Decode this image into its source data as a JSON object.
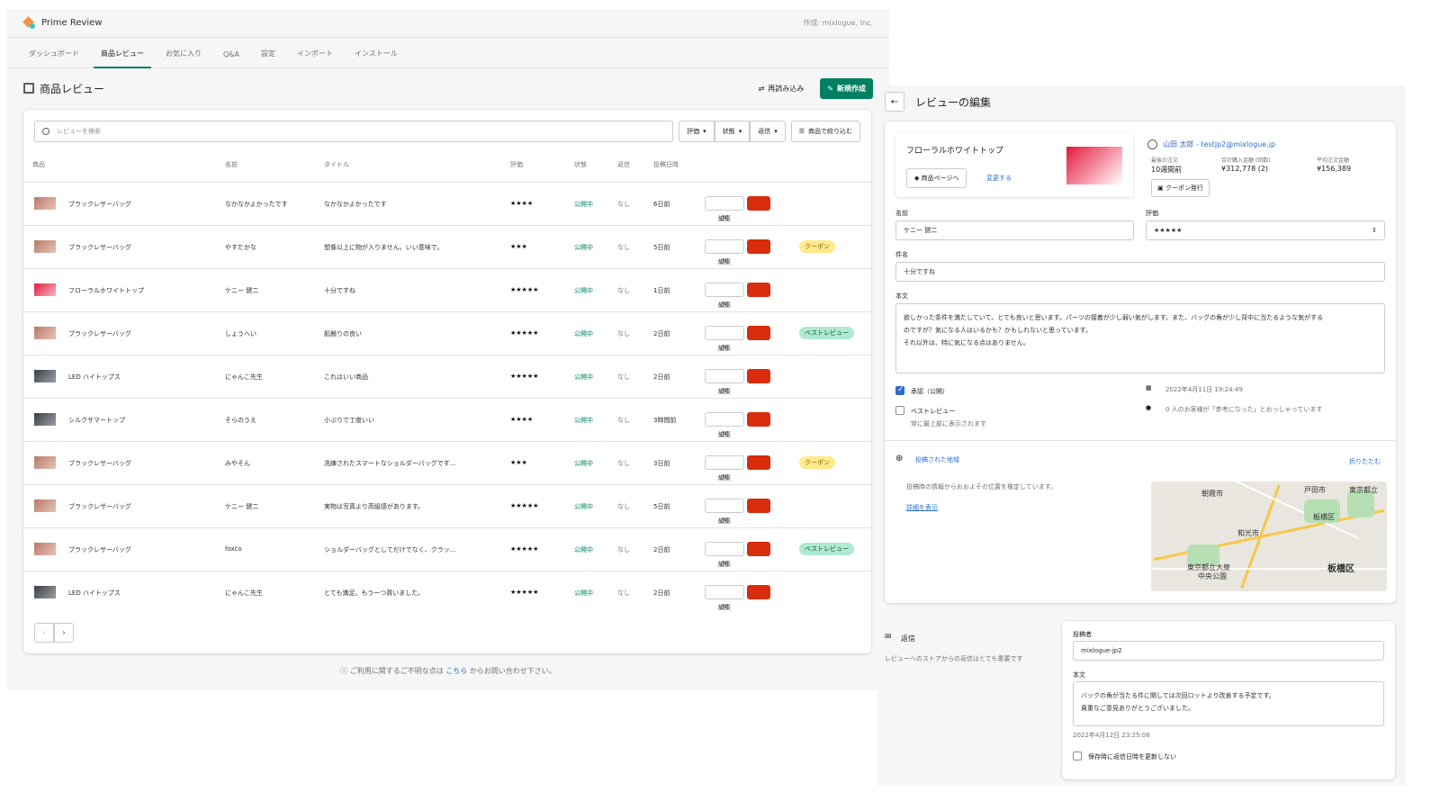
{
  "app": {
    "title": "Prime Review",
    "author": "作成: mixlogue, Inc."
  },
  "tabs": [
    "ダッシュボード",
    "商品レビュー",
    "お気に入り",
    "Q&A",
    "設定",
    "インポート",
    "インストール"
  ],
  "page": {
    "title": "商品レビュー",
    "reload": "再読み込み",
    "new": "新規作成"
  },
  "filters": {
    "search_placeholder": "レビューを検索",
    "rating": "評価",
    "status": "状態",
    "reply": "返信",
    "product": "商品で絞り込む"
  },
  "columns": [
    "商品",
    "名前",
    "タイトル",
    "評価",
    "状態",
    "返信",
    "投稿日時"
  ],
  "row_actions": {
    "edit": "編集"
  },
  "rows": [
    {
      "product": "ブラックレザーバッグ",
      "name": "なかなかよかったです",
      "title": "なかなかよかったです",
      "stars": "★★★★",
      "status": "公開中",
      "reply": "なし",
      "date": "6日前",
      "badge": "",
      "thumb": "bag"
    },
    {
      "product": "ブラックレザーバッグ",
      "name": "やすたかな",
      "title": "想像以上に物が入りません。いい意味で。",
      "stars": "★★★",
      "status": "公開中",
      "reply": "なし",
      "date": "5日前",
      "badge": "クーポン",
      "thumb": "bag"
    },
    {
      "product": "フローラルホワイトトップ",
      "name": "ケニー 健二",
      "title": "十分ですね",
      "stars": "★★★★★",
      "status": "公開中",
      "reply": "なし",
      "date": "1日前",
      "badge": "",
      "thumb": "red"
    },
    {
      "product": "ブラックレザーバッグ",
      "name": "しょうへい",
      "title": "肌触りの良い",
      "stars": "★★★★★",
      "status": "公開中",
      "reply": "なし",
      "date": "2日前",
      "badge": "ベストレビュー",
      "thumb": "bag"
    },
    {
      "product": "LED ハイトップス",
      "name": "にゃんこ先生",
      "title": "これはいい商品",
      "stars": "★★★★★",
      "status": "公開中",
      "reply": "なし",
      "date": "2日前",
      "badge": "",
      "thumb": "dark"
    },
    {
      "product": "シルクサマートップ",
      "name": "そらのうえ",
      "title": "小ぶりで丁度いい",
      "stars": "★★★★",
      "status": "公開中",
      "reply": "なし",
      "date": "3時間前",
      "badge": "",
      "thumb": "dark"
    },
    {
      "product": "ブラックレザーバッグ",
      "name": "みやそん",
      "title": "洗練されたスマートなショルダーバッグです...",
      "stars": "★★★",
      "status": "公開中",
      "reply": "なし",
      "date": "3日前",
      "badge": "クーポン",
      "thumb": "bag"
    },
    {
      "product": "ブラックレザーバッグ",
      "name": "ケニー 健二",
      "title": "実物は写真より高級感があります。",
      "stars": "★★★★★",
      "status": "公開中",
      "reply": "なし",
      "date": "5日前",
      "badge": "",
      "thumb": "bag"
    },
    {
      "product": "ブラックレザーバッグ",
      "name": "foxco",
      "title": "ショルダーバッグとしてだけでなく、クラッ...",
      "stars": "★★★★★",
      "status": "公開中",
      "reply": "なし",
      "date": "2日前",
      "badge": "ベストレビュー",
      "thumb": "bag"
    },
    {
      "product": "LED ハイトップス",
      "name": "にゃんこ先生",
      "title": "とても満足。もう一つ買いました。",
      "stars": "★★★★★",
      "status": "公開中",
      "reply": "なし",
      "date": "2日前",
      "badge": "",
      "thumb": "dark"
    }
  ],
  "footer": {
    "pre": "ご利用に関するご不明な点は",
    "link": "こちら",
    "post": "からお問い合わせ下さい。"
  },
  "edit": {
    "title": "レビューの編集",
    "product_name": "フローラルホワイトトップ",
    "product_page_btn": "商品ページへ",
    "change_link": "変更する",
    "customer": "山田 太郎 - testjp2@mixlogue.jp",
    "stats": [
      {
        "label": "最後の注文",
        "value": "10週間前"
      },
      {
        "label": "合計購入金額 (回数)",
        "value": "¥312,778 (2)"
      },
      {
        "label": "平均注文金額",
        "value": "¥156,389"
      }
    ],
    "coupon_btn": "クーポン発行",
    "name_label": "名前",
    "name_value": "ケニー 健二",
    "rating_label": "評価",
    "rating_value": "★★★★★",
    "subject_label": "件名",
    "subject_value": "十分ですね",
    "body_label": "本文",
    "body_lines": [
      "欲しかった条件を満たしていて、とても良いと思います。パーツの接着が少し弱い気がします。また、バッグの角が少し背中に当たるような気がする",
      "のですが？気になる人はいるかも？かもしれないと思っています。",
      "それ以外は、特に気になる点はありません。"
    ],
    "approve_label": "承認（公開）",
    "best_label": "ベストレビュー",
    "best_sub": "常に最上部に表示されます",
    "date": "2022年4月11日 19:24:49",
    "helpful": "0 人のお客様が「参考になった」とおっしゃっています",
    "region_label": "投稿された地域",
    "collapse": "折りたたむ",
    "region_desc": "投稿時の情報からおおよその位置を推定しています。",
    "region_detail": "詳細を表示",
    "map_labels": [
      "朝霞市",
      "戸田市",
      "東京都立",
      "板橋区",
      "和光市",
      "板橋区",
      "東京都立大泉",
      "中央公園"
    ]
  },
  "reply": {
    "title": "返信",
    "desc": "レビューへのストアからの返信はとても重要です",
    "author_label": "投稿者",
    "author_value": "mixlogue-jp2",
    "body_label": "本文",
    "body_lines": [
      "バックの角が当たる件に関しては次回ロットより改善する予定です。",
      "貴重なご意見ありがとうございました。"
    ],
    "date": "2022年4月12日 23:25:08",
    "keep_date": "保存時に返信日時を更新しない"
  }
}
